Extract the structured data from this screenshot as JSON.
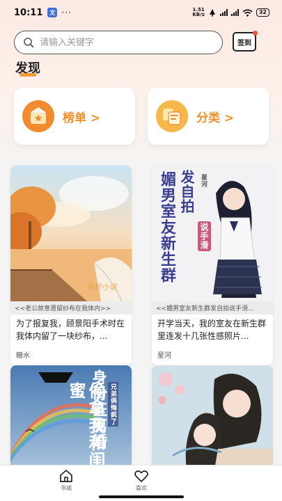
{
  "status_bar": {
    "time": "10:11",
    "app_icon_label": "文",
    "dots": "···",
    "net_speed_value": "1.51",
    "net_speed_unit": "KB/s",
    "battery": "32"
  },
  "search": {
    "placeholder": "请输入关键字"
  },
  "signin": {
    "label": "签到"
  },
  "section": {
    "title": "发现"
  },
  "categories": [
    {
      "label": "榜单 >"
    },
    {
      "label": "分类 >"
    }
  ],
  "books": [
    {
      "subtitle": "<<老公故意遗留纱布在我体内>>",
      "description": "为了报复我，顾景阳手术时在我体内留了一块纱布，...",
      "author": "糖水"
    },
    {
      "cover_title": "媚男室友新生群",
      "cover_title_right": "发自拍",
      "cover_badge": "说手滑",
      "cover_author": "星河",
      "subtitle": "<<媚男室友新生群发自拍说手滑...",
      "description": "开学当天，我的室友在新生群里连发十几张性感照片...",
      "author": "星河"
    },
    {
      "cover_title": "偷拿我和闺蜜",
      "cover_title_right": "身份证离婚",
      "cover_badge": "兄弟俩悔疯了"
    },
    {}
  ],
  "bottom_nav": [
    {
      "label": "书城"
    },
    {
      "label": "喜欢"
    }
  ],
  "colors": {
    "accent": "#f0902b",
    "icon_orange": "#f28b2f",
    "badge_red": "#f0503c"
  }
}
